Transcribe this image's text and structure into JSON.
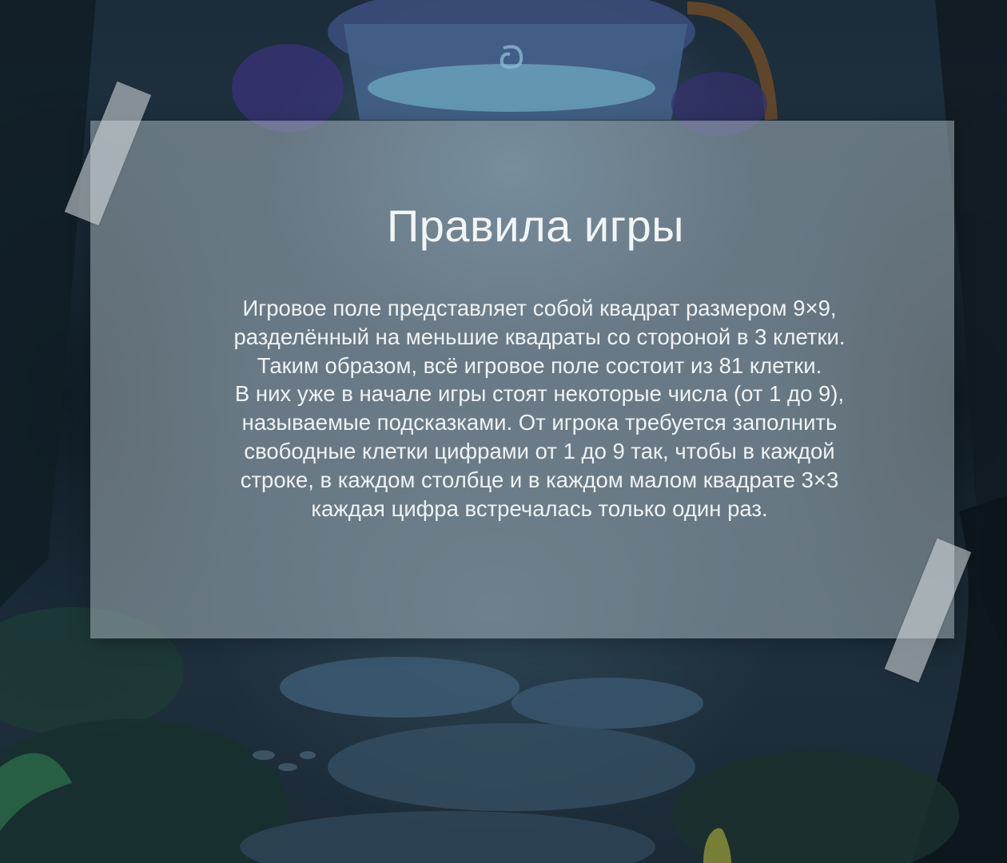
{
  "screen": {
    "title": "Правила игры",
    "rules_lines": [
      "Игровое поле представляет собой квадрат размером 9×9,",
      "разделённый на меньшие квадраты со стороной в 3 клетки.",
      "Таким образом, всё игровое поле состоит из 81 клетки.",
      "В них уже в начале игры стоят некоторые числа (от 1 до 9),",
      "называемые подсказками. От игрока требуется заполнить",
      "свободные клетки цифрами от 1 до 9 так, чтобы в каждой",
      "строке, в каждом столбце и в каждом малом квадрате 3×3",
      "каждая цифра встречалась только один раз."
    ]
  },
  "colors": {
    "paper": "#aab9c0",
    "text": "#eef2f4",
    "background": "#1c2c3a"
  }
}
